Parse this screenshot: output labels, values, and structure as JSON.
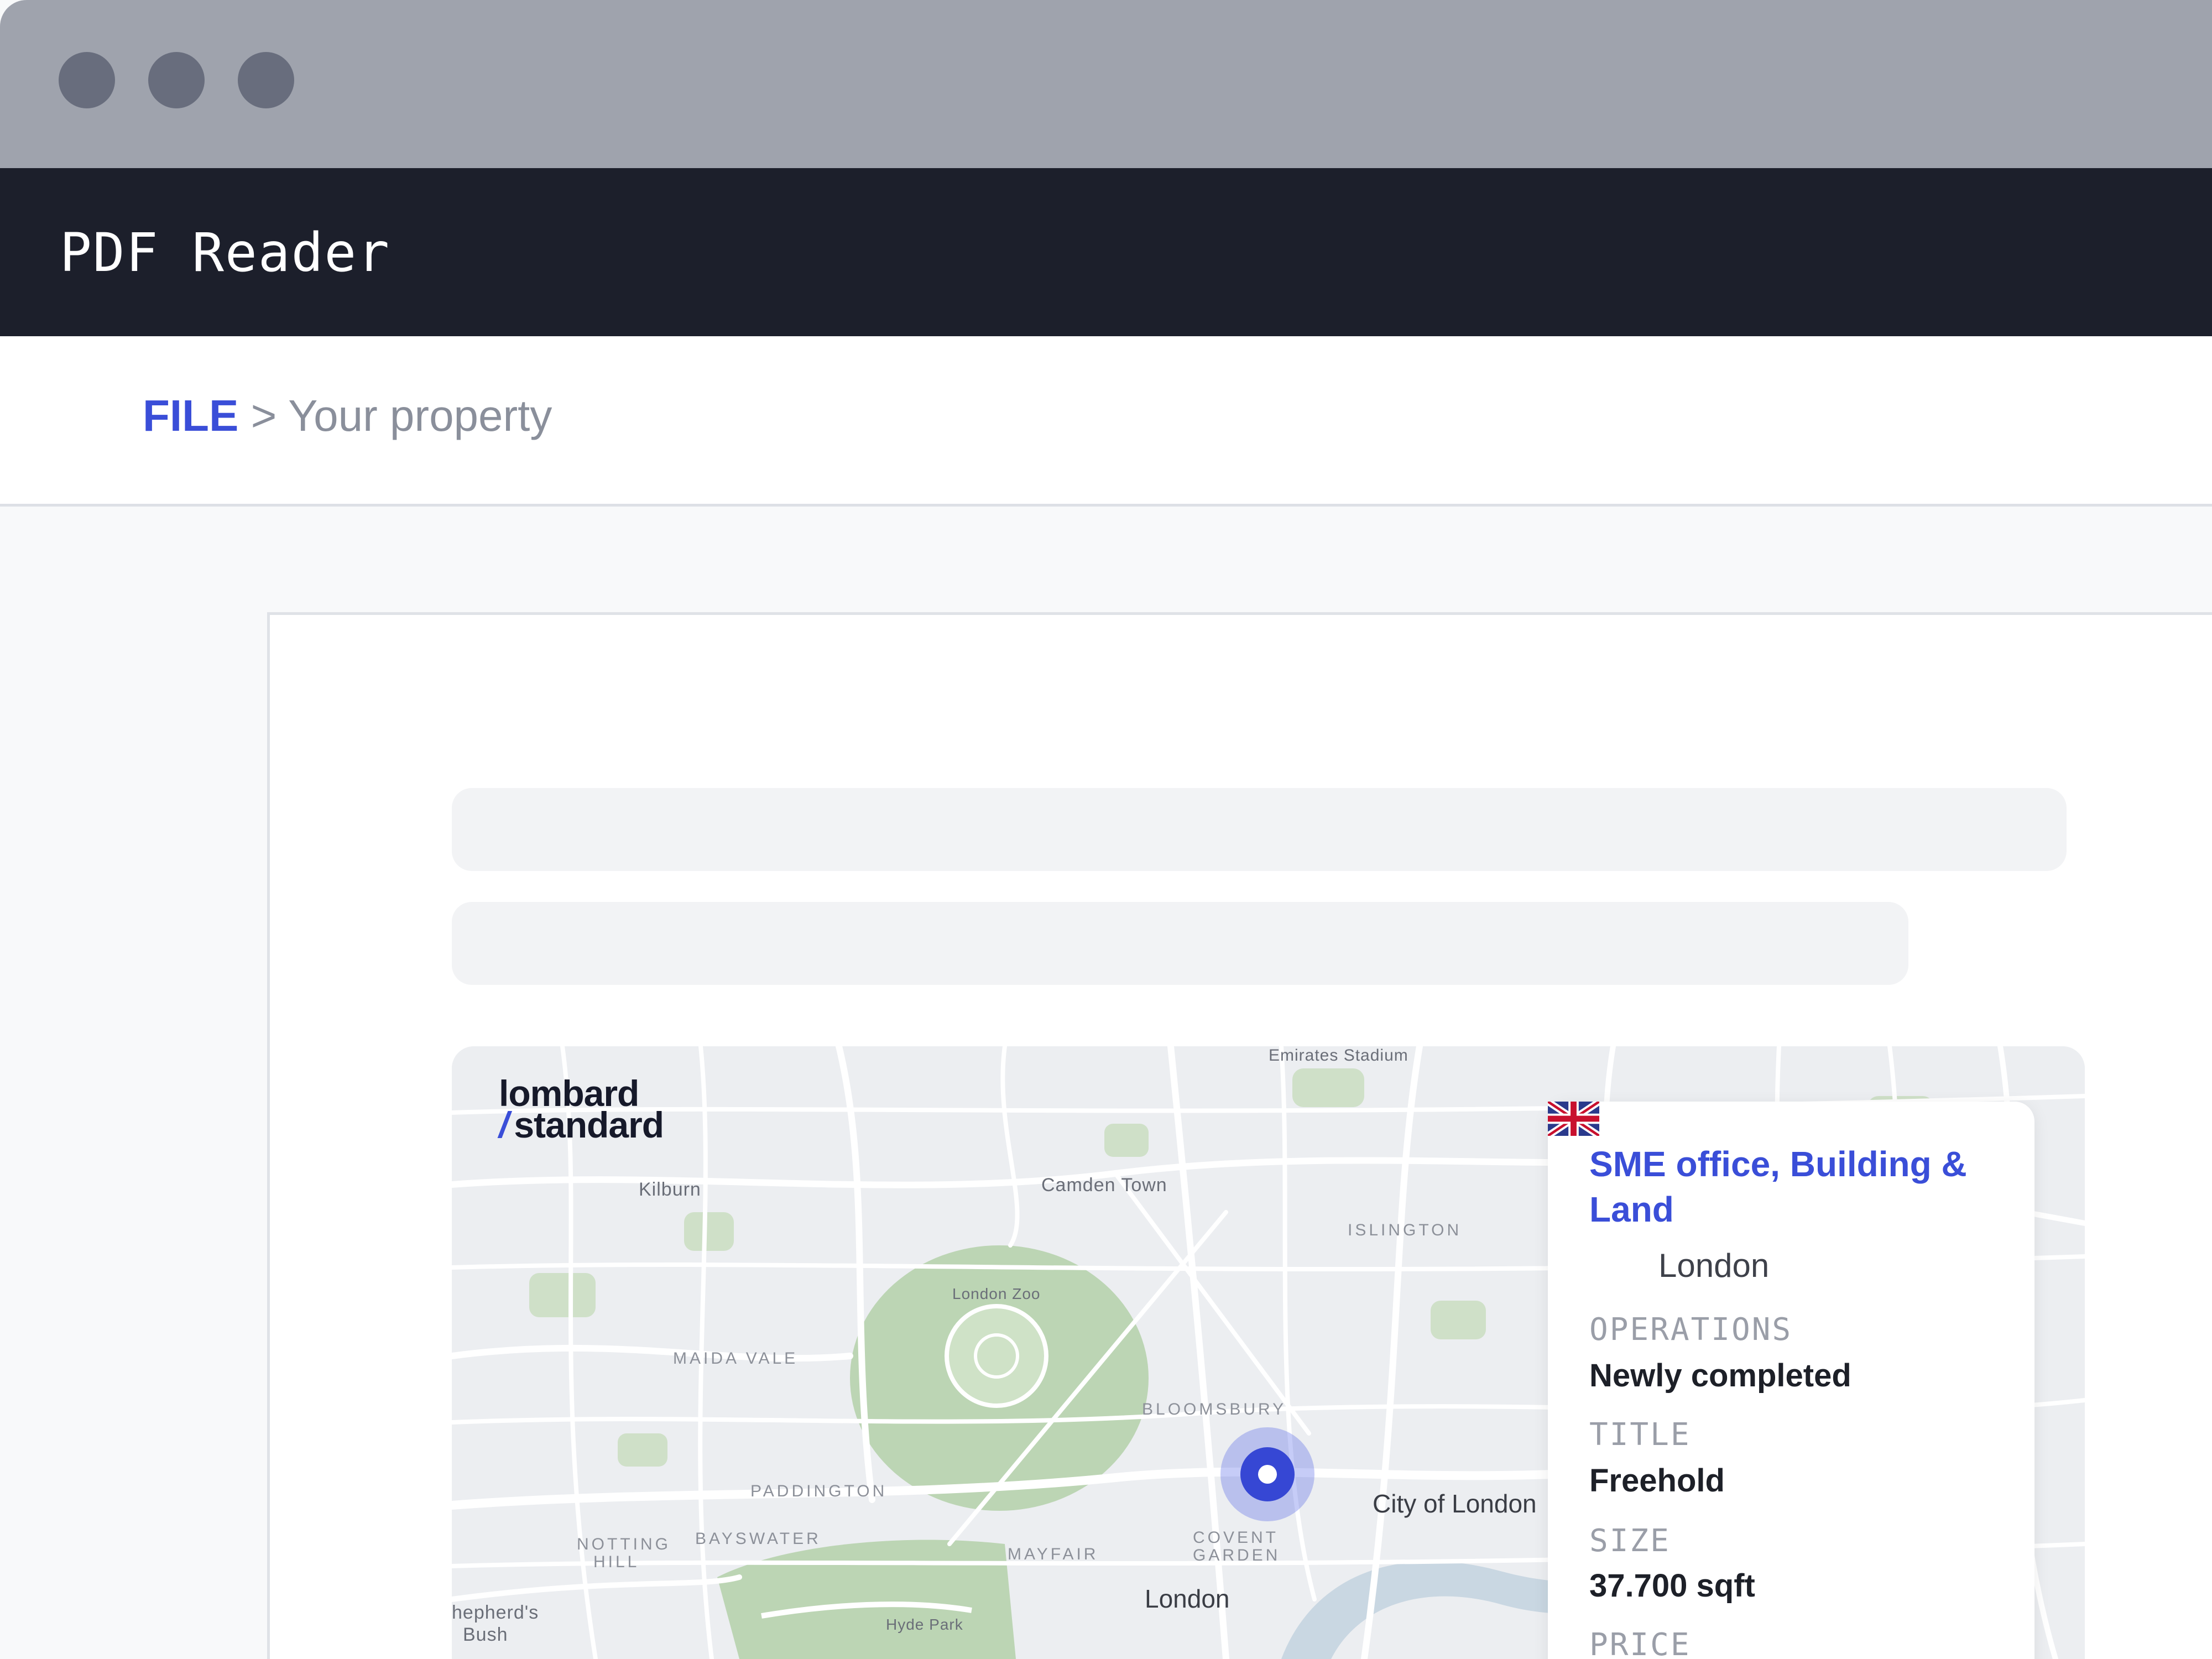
{
  "window": {
    "title": "PDF Reader"
  },
  "breadcrumb": {
    "root": "FILE",
    "separator": ">",
    "current": "Your property"
  },
  "map": {
    "brand": {
      "line1": "lombard",
      "slash": "/",
      "line2": "standard"
    },
    "labels": {
      "emirates": "Emirates Stadium",
      "kilburn": "Kilburn",
      "camden": "Camden Town",
      "islington": "ISLINGTON",
      "zoo": "London Zoo",
      "maida": "MAIDA VALE",
      "bloomsbury": "BLOOMSBURY",
      "paddington": "PADDINGTON",
      "bayswater": "BAYSWATER",
      "notting1": "NOTTING",
      "notting2": "HILL",
      "mayfair": "MAYFAIR",
      "covent1": "COVENT",
      "covent2": "GARDEN",
      "city": "City of London",
      "london": "London",
      "hydepark": "Hyde Park",
      "shepherds1": "hepherd's",
      "shepherds2": "Bush"
    }
  },
  "property": {
    "title": "SME office, Building & Land",
    "flag": "uk-flag-icon",
    "location": "London",
    "operations_label": "OPERATIONS",
    "operations_value": "Newly completed",
    "title_label": "TITLE",
    "title_value": "Freehold",
    "size_label": "SIZE",
    "size_value": "37.700 sqft",
    "price_label": "PRICE"
  },
  "colors": {
    "accent": "#3a4ed8",
    "appbar": "#1c1f2b",
    "titlebar": "#9fa3ad",
    "park": "#bcd5b4",
    "river": "#c9d7e2"
  }
}
